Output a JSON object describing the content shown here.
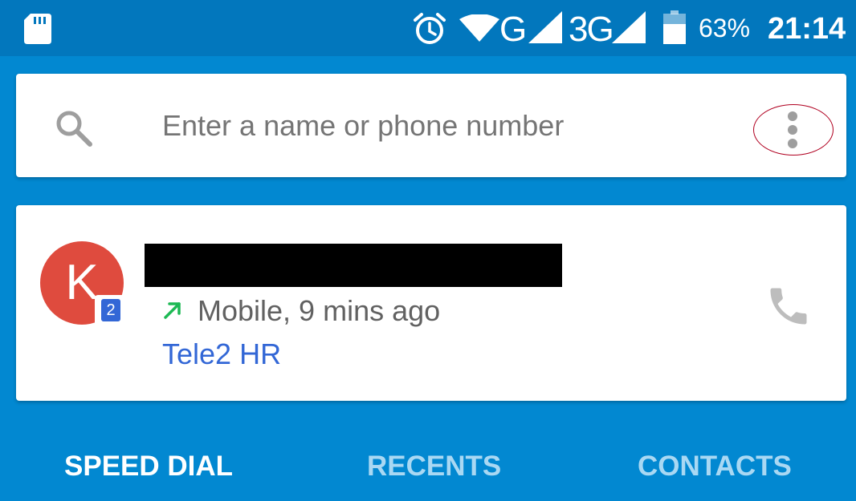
{
  "status_bar": {
    "network_1": "G",
    "network_2": "3G",
    "battery": "63%",
    "time": "21:14",
    "icons": [
      "sd-card-icon",
      "alarm-icon",
      "wifi-icon",
      "signal-icon",
      "signal-icon",
      "battery-icon"
    ]
  },
  "search": {
    "placeholder": "Enter a name or phone number",
    "icon": "search-icon",
    "menu_icon": "more-vert-icon"
  },
  "recent_call": {
    "avatar_letter": "K",
    "sim_slot": "2",
    "detail": "Mobile, 9 mins ago",
    "carrier": "Tele2 HR",
    "direction_icon": "outgoing-arrow-icon",
    "action_icon": "phone-icon"
  },
  "tabs": [
    {
      "label": "SPEED DIAL",
      "active": true
    },
    {
      "label": "RECENTS",
      "active": false
    },
    {
      "label": "CONTACTS",
      "active": false
    }
  ],
  "colors": {
    "primary": "#0288d1",
    "status_bar": "#0277bd",
    "avatar": "#df4b3e",
    "carrier_link": "#3367d6",
    "outgoing_arrow": "#1db954",
    "tab_inactive": "#a9d8f3"
  }
}
